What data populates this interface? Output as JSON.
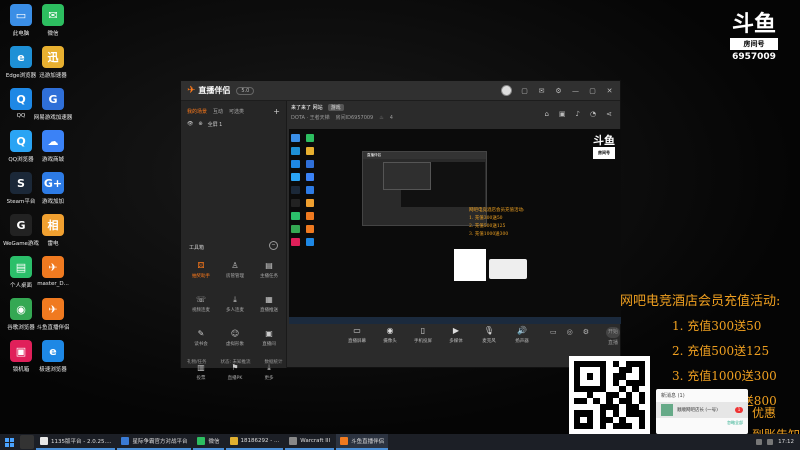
{
  "desktop": {
    "icons": [
      {
        "label": "此电脑",
        "color": "#3a8ee6",
        "glyph": "▭"
      },
      {
        "label": "微信",
        "color": "#2dbe60",
        "glyph": "✉"
      },
      {
        "label": "Edge浏览器",
        "color": "#1e90d6",
        "glyph": "e"
      },
      {
        "label": "迅游加速器",
        "color": "#e8b030",
        "glyph": "迅"
      },
      {
        "label": "QQ",
        "color": "#1e88e5",
        "glyph": "Q"
      },
      {
        "label": "网易游戏加速器",
        "color": "#2f6fd8",
        "glyph": "G"
      },
      {
        "label": "QQ浏览器",
        "color": "#2aa4f4",
        "glyph": "Q"
      },
      {
        "label": "游戏商城",
        "color": "#3b82f6",
        "glyph": "☁"
      },
      {
        "label": "Steam平台",
        "color": "#1b2838",
        "glyph": "S"
      },
      {
        "label": "游戏加加",
        "color": "#2d7be5",
        "glyph": "G+"
      },
      {
        "label": "WeGame游戏",
        "color": "#222",
        "glyph": "G"
      },
      {
        "label": "雷电",
        "color": "#f0a030",
        "glyph": "相"
      },
      {
        "label": "个人桌面",
        "color": "#2bbf6a",
        "glyph": "▤"
      },
      {
        "label": "master_D...",
        "color": "#f07a20",
        "glyph": "✈"
      },
      {
        "label": "谷歌浏览器",
        "color": "#34a853",
        "glyph": "◉"
      },
      {
        "label": "斗鱼直播伴侣",
        "color": "#f07a20",
        "glyph": "✈"
      },
      {
        "label": "锁机箱",
        "color": "#e0205a",
        "glyph": "▣"
      },
      {
        "label": "极速浏览器",
        "color": "#1e88e5",
        "glyph": "e"
      }
    ]
  },
  "logo": {
    "mark": "斗鱼",
    "room_label": "房间号",
    "room_number": "6957009"
  },
  "window": {
    "app_name": "直播伴侣",
    "version": "5.0",
    "left_tabs": [
      "我的场景",
      "互动",
      "可选类"
    ],
    "scene_name": "全屏 1",
    "tools_title": "工具箱",
    "tools": [
      {
        "label": "抽奖助手",
        "glyph": "⚄",
        "hot": true
      },
      {
        "label": "房管管理",
        "glyph": "♙",
        "hot": false
      },
      {
        "label": "主播任务",
        "glyph": "▤",
        "hot": false
      },
      {
        "label": "视频连麦",
        "glyph": "☏",
        "hot": false
      },
      {
        "label": "多人连麦",
        "glyph": "⤓",
        "hot": false
      },
      {
        "label": "直播推送",
        "glyph": "▦",
        "hot": false
      },
      {
        "label": "读书会",
        "glyph": "✎",
        "hot": false
      },
      {
        "label": "虚拟形象",
        "glyph": "☺",
        "hot": false
      },
      {
        "label": "直播间",
        "glyph": "▣",
        "hot": false
      },
      {
        "label": "投票",
        "glyph": "▥",
        "hot": false
      },
      {
        "label": "直播PK",
        "glyph": "⚑",
        "hot": false
      },
      {
        "label": "更多",
        "glyph": "⤓",
        "hot": false
      }
    ],
    "stream_title": "来了来了 网站",
    "stream_tag": "游戏",
    "category": "DOTA · 王者天梯",
    "room_id_label": "房间ID6957009",
    "viewers": "4",
    "bottom_tools": [
      {
        "label": "直播屏幕",
        "glyph": "▭"
      },
      {
        "label": "摄像头",
        "glyph": "◉"
      },
      {
        "label": "手机投屏",
        "glyph": "▯"
      },
      {
        "label": "多媒体",
        "glyph": "▶"
      },
      {
        "label": "麦克风",
        "glyph": "🎙"
      },
      {
        "label": "扬声器",
        "glyph": "🔊"
      }
    ],
    "start_button": "开始直播",
    "status_items": [
      "礼物/任务",
      "状态: 未知推流",
      "数据统计"
    ],
    "status_right": "帧率/码率"
  },
  "preview": {
    "promo_lines": [
      "网吧电竞酒店会员充值活动:",
      "1. 充值300送50",
      "2. 充值500送125",
      "3. 充值1000送300"
    ]
  },
  "promo": {
    "title": "网吧电竞酒店会员充值活动:",
    "lines": [
      "1. 充值300送50",
      "2. 充值500送125",
      "3. 充值1000送300",
      "4. 充值2000送800"
    ],
    "partial_right": [
      "优惠",
      "到账告知"
    ]
  },
  "wechat_card": {
    "header": "新消息 (1)",
    "name": "顺顺网吧店长 (一号)",
    "badge": "1",
    "footer": "忽略全部"
  },
  "taskbar": {
    "apps": [
      {
        "label": "1135版平台 - 2.0.25....",
        "color": "#e8e8e8",
        "active": false
      },
      {
        "label": "星际争霸官方对战平台",
        "color": "#3a7bd5",
        "active": false
      },
      {
        "label": "微信",
        "color": "#2dbe60",
        "active": false
      },
      {
        "label": "18186292 - ...",
        "color": "#e0b030",
        "active": false
      },
      {
        "label": "Warcraft III",
        "color": "#888888",
        "active": false
      },
      {
        "label": "斗鱼直播伴侣",
        "color": "#f07a20",
        "active": true
      }
    ],
    "clock": "17:12"
  },
  "colors": {
    "accent": "#ff7a1a",
    "promo": "#f0a020",
    "taskbar": "#1c1f26"
  }
}
